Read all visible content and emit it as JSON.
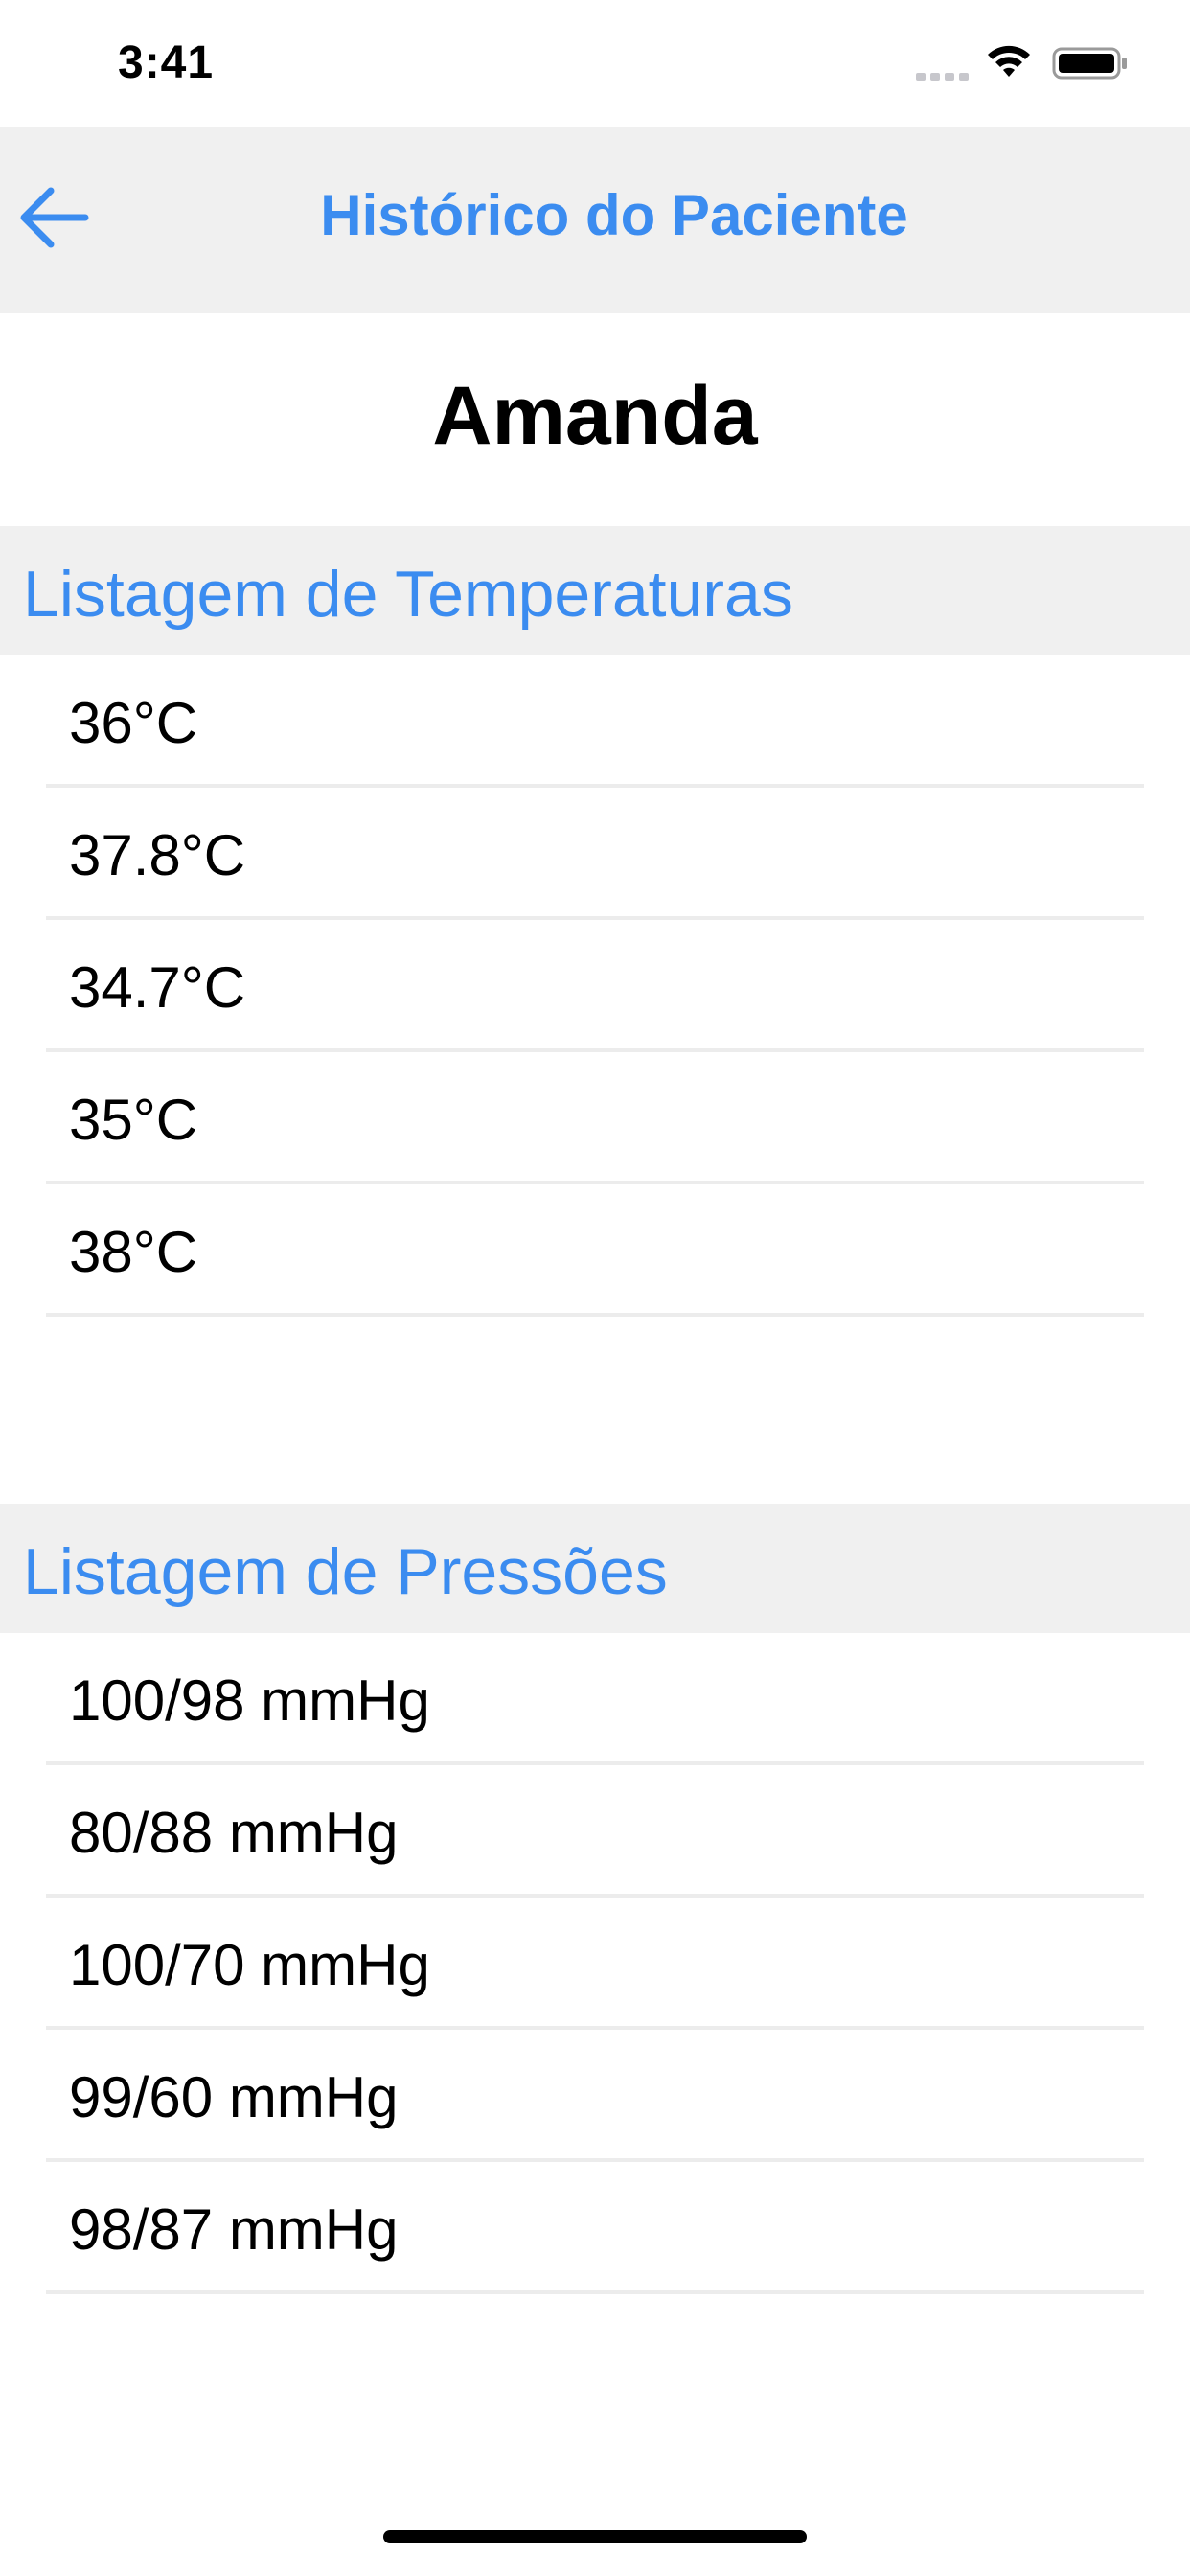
{
  "status_bar": {
    "time": "3:41"
  },
  "nav": {
    "title": "Histórico do Paciente",
    "back_icon": "arrow-left-icon"
  },
  "patient": {
    "name": "Amanda"
  },
  "temperatures": {
    "header": "Listagem de Temperaturas",
    "items": [
      "36°C",
      "37.8°C",
      "34.7°C",
      "35°C",
      "38°C"
    ]
  },
  "pressures": {
    "header": "Listagem de Pressões",
    "items": [
      "100/98 mmHg",
      "80/88 mmHg",
      "100/70 mmHg",
      "99/60 mmHg",
      "98/87 mmHg"
    ]
  },
  "colors": {
    "accent": "#3b8cf0",
    "section_bg": "#f0f0f0",
    "separator": "#ececec"
  }
}
